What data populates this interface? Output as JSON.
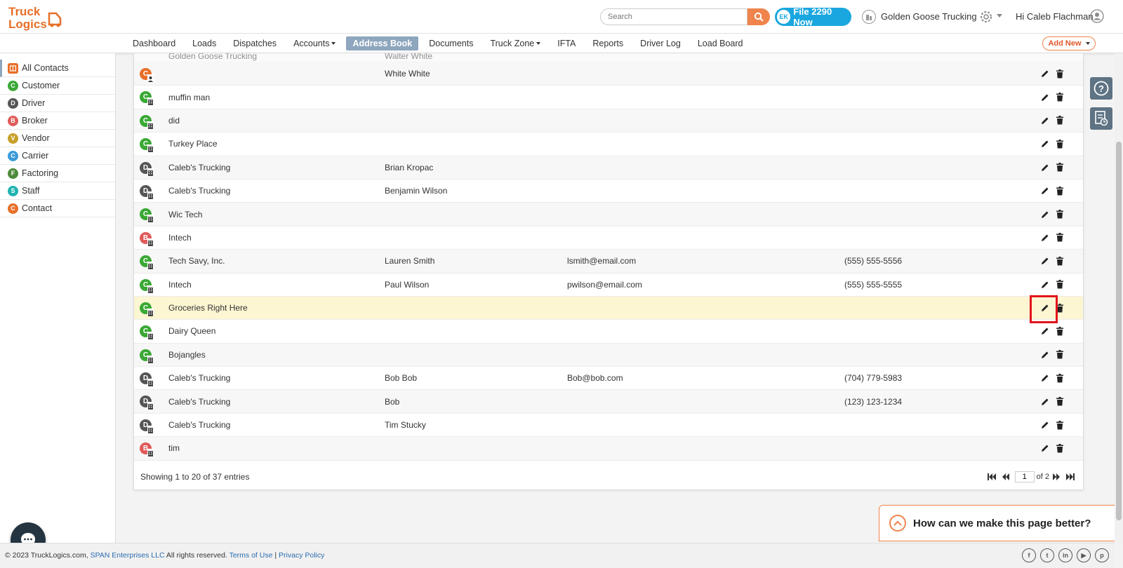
{
  "colors": {
    "customer": "#3aa835",
    "driver": "#555555",
    "broker": "#e05a5a",
    "vendor": "#c8a02a",
    "carrier": "#3b9ad9",
    "factoring": "#4d8a3a",
    "staff": "#1fb3b0",
    "contact": "#e76f28",
    "accent": "#f0844c",
    "highlight": "#fdf6d2"
  },
  "header": {
    "logo_line1": "Truck",
    "logo_line2": "Logics",
    "search_placeholder": "Search",
    "file_btn_prefix": "EK",
    "file_btn_label": "File 2290 Now",
    "company_name": "Golden Goose Trucking",
    "greeting": "Hi Caleb Flachman"
  },
  "nav": {
    "items": [
      "Dashboard",
      "Loads",
      "Dispatches",
      "Accounts",
      "Address Book",
      "Documents",
      "Truck Zone",
      "IFTA",
      "Reports",
      "Driver Log",
      "Load Board"
    ],
    "add_new": "Add New"
  },
  "sidebar": {
    "items": [
      {
        "label": "All Contacts",
        "badge": ""
      },
      {
        "label": "Customer",
        "badge": "C"
      },
      {
        "label": "Driver",
        "badge": "D"
      },
      {
        "label": "Broker",
        "badge": "B"
      },
      {
        "label": "Vendor",
        "badge": "V"
      },
      {
        "label": "Carrier",
        "badge": "C"
      },
      {
        "label": "Factoring",
        "badge": "F"
      },
      {
        "label": "Staff",
        "badge": "S"
      },
      {
        "label": "Contact",
        "badge": "C"
      }
    ]
  },
  "table": {
    "partial_row": {
      "name": "Golden Goose Trucking",
      "contact": "Walter White"
    },
    "rows": [
      {
        "badge": "C",
        "type": "contact",
        "name": "",
        "contact": "White White",
        "email": "",
        "phone": ""
      },
      {
        "badge": "C",
        "type": "customer",
        "name": "muffin man",
        "contact": "",
        "email": "",
        "phone": ""
      },
      {
        "badge": "C",
        "type": "customer",
        "name": "did",
        "contact": "",
        "email": "",
        "phone": ""
      },
      {
        "badge": "C",
        "type": "customer",
        "name": "Turkey Place",
        "contact": "",
        "email": "",
        "phone": ""
      },
      {
        "badge": "D",
        "type": "driver",
        "name": "Caleb's Trucking",
        "contact": "Brian Kropac",
        "email": "",
        "phone": ""
      },
      {
        "badge": "D",
        "type": "driver",
        "name": "Caleb's Trucking",
        "contact": "Benjamin Wilson",
        "email": "",
        "phone": ""
      },
      {
        "badge": "C",
        "type": "customer",
        "name": "Wic Tech",
        "contact": "",
        "email": "",
        "phone": ""
      },
      {
        "badge": "B",
        "type": "broker",
        "name": "Intech",
        "contact": "",
        "email": "",
        "phone": ""
      },
      {
        "badge": "C",
        "type": "customer",
        "name": "Tech Savy, Inc.",
        "contact": "Lauren Smith",
        "email": "lsmith@email.com",
        "phone": "(555) 555-5556"
      },
      {
        "badge": "C",
        "type": "customer",
        "name": "Intech",
        "contact": "Paul Wilson",
        "email": "pwilson@email.com",
        "phone": "(555) 555-5555"
      },
      {
        "badge": "C",
        "type": "customer",
        "name": "Groceries Right Here",
        "contact": "",
        "email": "",
        "phone": "",
        "highlight": true
      },
      {
        "badge": "C",
        "type": "customer",
        "name": "Dairy Queen",
        "contact": "",
        "email": "",
        "phone": ""
      },
      {
        "badge": "C",
        "type": "customer",
        "name": "Bojangles",
        "contact": "",
        "email": "",
        "phone": ""
      },
      {
        "badge": "D",
        "type": "driver",
        "name": "Caleb's Trucking",
        "contact": "Bob Bob",
        "email": "Bob@bob.com",
        "phone": "(704) 779-5983"
      },
      {
        "badge": "D",
        "type": "driver",
        "name": "Caleb's Trucking",
        "contact": "Bob",
        "email": "",
        "phone": "(123) 123-1234"
      },
      {
        "badge": "D",
        "type": "driver",
        "name": "Caleb's Trucking",
        "contact": "Tim Stucky",
        "email": "",
        "phone": ""
      },
      {
        "badge": "B",
        "type": "broker",
        "name": "tim",
        "contact": "",
        "email": "",
        "phone": ""
      }
    ],
    "showing": "Showing 1 to 20 of 37 entries",
    "page": "1",
    "of_pages": "of 2"
  },
  "feedback": {
    "text": "How can we make this page better?"
  },
  "footer": {
    "copyright_pre": "© 2023 TruckLogics.com,",
    "company_link": "SPAN Enterprises LLC",
    "rights": "All rights reserved.",
    "terms": "Terms of Use",
    "separator": "|",
    "privacy": "Privacy Policy",
    "socials": [
      "f",
      "t",
      "in",
      "▶",
      "p"
    ]
  }
}
